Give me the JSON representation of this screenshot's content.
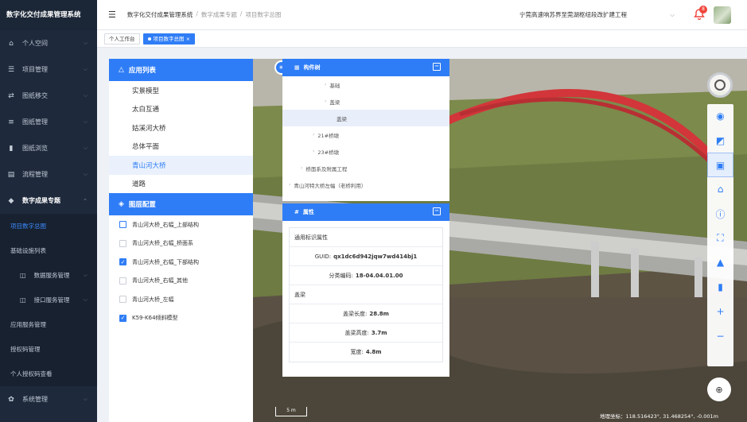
{
  "app": {
    "title": "数字化交付成果管理系统"
  },
  "sidebar": {
    "items": [
      {
        "label": "个人空间",
        "icon": "home-icon",
        "glyph": "⌂"
      },
      {
        "label": "项目管理",
        "icon": "list-icon",
        "glyph": "☰"
      },
      {
        "label": "图纸移交",
        "icon": "transfer-icon",
        "glyph": "⇄"
      },
      {
        "label": "图纸管理",
        "icon": "drawing-icon",
        "glyph": "≡"
      },
      {
        "label": "图纸浏览",
        "icon": "browse-icon",
        "glyph": "▮"
      },
      {
        "label": "流程管理",
        "icon": "flow-icon",
        "glyph": "▤"
      },
      {
        "label": "数字成果专题",
        "icon": "digital-icon",
        "glyph": "◆"
      }
    ],
    "subitems": [
      {
        "label": "项目数字总图"
      },
      {
        "label": "基础设施列表"
      },
      {
        "label": "数据服务管理",
        "glyph": "◫"
      },
      {
        "label": "接口服务管理",
        "glyph": "◫"
      },
      {
        "label": "应用服务管理"
      },
      {
        "label": "授权码管理"
      },
      {
        "label": "个人授权码查看"
      }
    ],
    "footer": {
      "label": "系统管理",
      "icon": "settings-icon",
      "glyph": "✿"
    }
  },
  "header": {
    "breadcrumb": [
      "数字化交付成果管理系统",
      "数字成果专题",
      "项目数字总图"
    ],
    "project": "宁莞高速响苏界至莞湖枢纽段改扩建工程",
    "notifications": "8"
  },
  "tabs": [
    {
      "label": "个人工作台"
    },
    {
      "label": "项目数字总图"
    }
  ],
  "app_list": {
    "title": "应用列表",
    "items": [
      "实景模型",
      "太白互通",
      "姑溪河大桥",
      "总体平面",
      "青山河大桥",
      "道路"
    ]
  },
  "layer_config": {
    "title": "图层配置",
    "items": [
      {
        "label": "青山河大桥_右幅_上部结构",
        "checked": false
      },
      {
        "label": "青山河大桥_右幅_桥面系",
        "checked": false
      },
      {
        "label": "青山河大桥_右幅_下部结构",
        "checked": true
      },
      {
        "label": "青山河大桥_右幅_其他",
        "checked": false
      },
      {
        "label": "青山河大桥_左幅",
        "checked": false
      },
      {
        "label": "K59-K64倾斜模型",
        "checked": true
      }
    ]
  },
  "component_tree": {
    "title": "构件树",
    "rows": [
      {
        "label": "基础",
        "indent": 3
      },
      {
        "label": "盖梁",
        "indent": 3
      },
      {
        "label": "盖梁",
        "indent": 4
      },
      {
        "label": "21#桥墩",
        "indent": 2
      },
      {
        "label": "23#桥墩",
        "indent": 2
      },
      {
        "label": "桥面系及附属工程",
        "indent": 1
      },
      {
        "label": "青山河特大桥左幅（老桥利用）",
        "indent": 0
      }
    ]
  },
  "properties": {
    "title": "属性",
    "section1": "通用标识属性",
    "guid_label": "GUID:",
    "guid_value": "qx1dc6d942jqw7wd414bj1",
    "code_label": "分类编码:",
    "code_value": "18-04.04.01.00",
    "section2": "盖梁",
    "length_label": "盖梁长度:",
    "length_value": "28.8m",
    "height_label": "盖梁高度:",
    "height_value": "3.7m",
    "width_label": "宽度:",
    "width_value": "4.8m"
  },
  "map": {
    "scale": "5 m",
    "coords": "地理坐标：118.516423°, 31.468254°, -0.001m"
  },
  "toolbar": [
    "layers-icon",
    "view-icon",
    "frame-icon",
    "building-icon",
    "info-icon",
    "measure-icon",
    "home-icon",
    "marker-icon",
    "zoom-in-icon",
    "zoom-out-icon"
  ],
  "toolbar_glyphs": [
    "◉",
    "◩",
    "▣",
    "⌂",
    "ⓘ",
    "⛶",
    "▲",
    "▮",
    "+",
    "−"
  ]
}
